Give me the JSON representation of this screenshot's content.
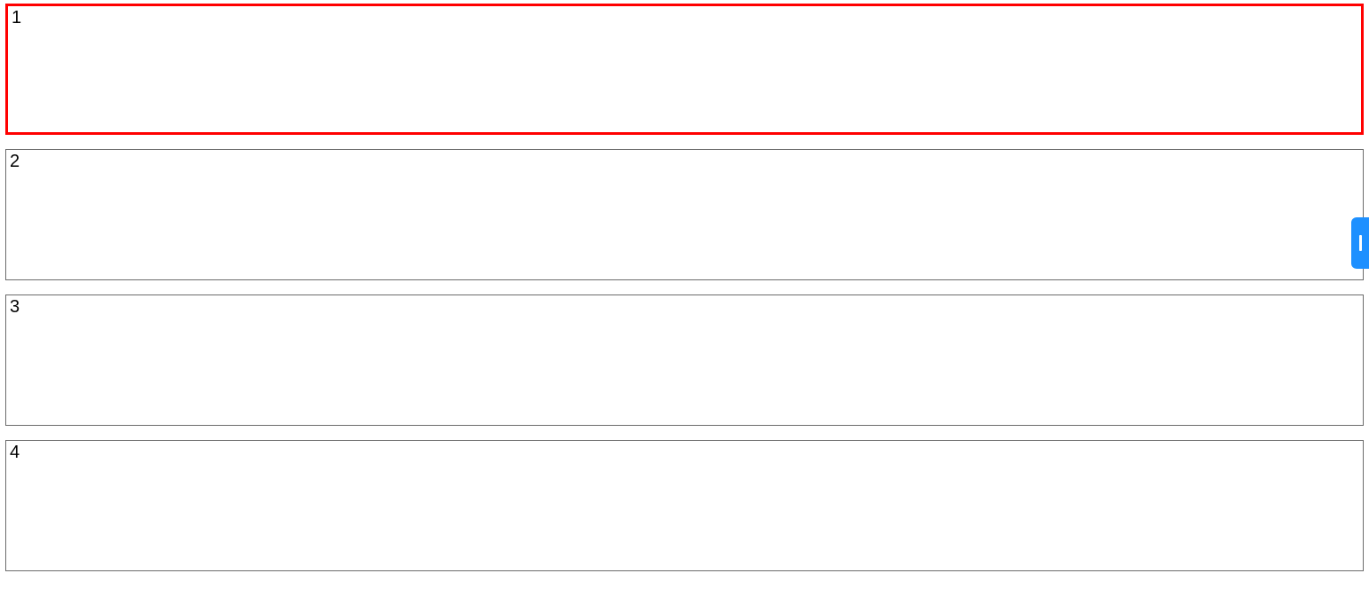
{
  "boxes": [
    {
      "label": "1",
      "selected": true
    },
    {
      "label": "2",
      "selected": false
    },
    {
      "label": "3",
      "selected": false
    },
    {
      "label": "4",
      "selected": false
    }
  ]
}
